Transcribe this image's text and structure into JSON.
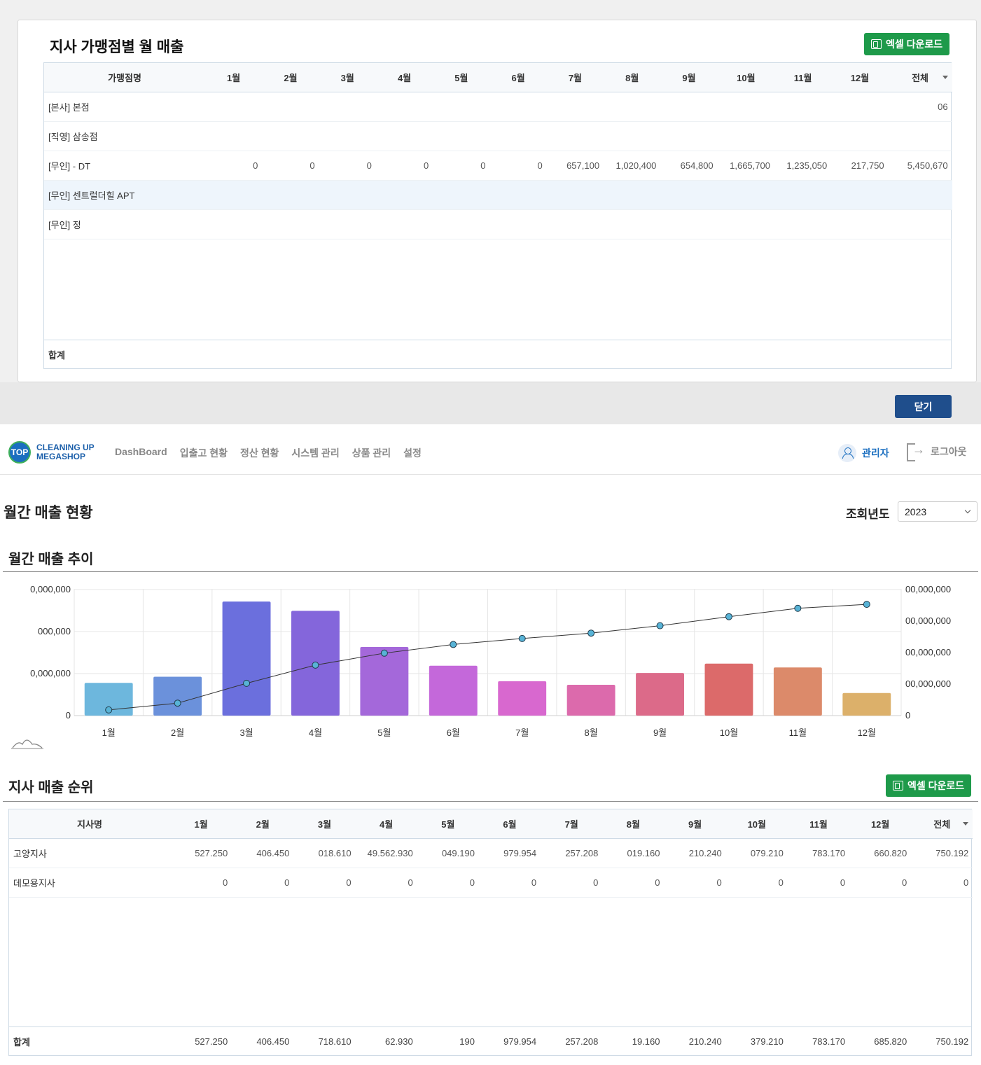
{
  "modal": {
    "title": "지사 가맹점별 월 매출",
    "download_label": "엑셀 다운로드",
    "columns": [
      "가맹점명",
      "1월",
      "2월",
      "3월",
      "4월",
      "5월",
      "6월",
      "7월",
      "8월",
      "9월",
      "10월",
      "11월",
      "12월",
      "전체"
    ],
    "rows": [
      {
        "name": "[본사] 본점",
        "values": [
          "",
          "",
          "",
          "",
          "",
          "",
          "",
          "",
          "",
          "",
          "",
          "",
          "06"
        ]
      },
      {
        "name": "[직영] 삼송점",
        "values": [
          "",
          "",
          "",
          "",
          "",
          "",
          "",
          "",
          "",
          "",
          "",
          "",
          ""
        ]
      },
      {
        "name": "[무인] - DT",
        "values": [
          "0",
          "0",
          "0",
          "0",
          "0",
          "0",
          "657,100",
          "1,020,400",
          "654,800",
          "1,665,700",
          "1,235,050",
          "217,750",
          "5,450,670"
        ]
      },
      {
        "name": "[무인] 센트럴더힐 APT",
        "values": [
          "",
          "",
          "",
          "",
          "",
          "",
          "",
          "",
          "",
          "",
          "",
          "",
          ""
        ]
      },
      {
        "name": "[무인] 정",
        "values": [
          "",
          "",
          "",
          "",
          "",
          "",
          "",
          "",
          "",
          "",
          "",
          "",
          ""
        ]
      }
    ],
    "total_label": "합계",
    "totals": [
      "",
      "",
      "",
      "",
      "",
      "",
      "",
      "",
      "",
      "",
      "",
      "",
      ""
    ],
    "close_label": "닫기"
  },
  "navbar": {
    "logo_mark": "TOP",
    "logo_line1": "CLEANING UP",
    "logo_line2": "MEGASHOP",
    "menu": [
      "DashBoard",
      "입출고 현황",
      "정산 현황",
      "시스템 관리",
      "상품 관리",
      "설정"
    ],
    "user_label": "관리자",
    "logout_label": "로그아웃"
  },
  "page": {
    "title": "월간 매출 현황",
    "year_label": "조회년도",
    "year_value": "2023"
  },
  "trend_section": {
    "title": "월간 매출 추이"
  },
  "ranking": {
    "title": "지사 매출 순위",
    "download_label": "엑셀 다운로드",
    "columns": [
      "지사명",
      "1월",
      "2월",
      "3월",
      "4월",
      "5월",
      "6월",
      "7월",
      "8월",
      "9월",
      "10월",
      "11월",
      "12월",
      "전체"
    ],
    "rows": [
      {
        "name": "고양지사",
        "values": [
          "527.250",
          "406.450",
          "018.610",
          "49.562.930",
          "049.190",
          "979.954",
          "257.208",
          "019.160",
          "210.240",
          "079.210",
          "783.170",
          "660.820",
          "750.192"
        ]
      },
      {
        "name": "데모용지사",
        "values": [
          "0",
          "0",
          "0",
          "0",
          "0",
          "0",
          "0",
          "0",
          "0",
          "0",
          "0",
          "0",
          "0"
        ]
      }
    ],
    "total_label": "합계",
    "totals": [
      "527.250",
      "406.450",
      "718.610",
      "62.930",
      "190",
      "979.954",
      "257.208",
      "19.160",
      "210.240",
      "379.210",
      "783.170",
      "685.820",
      "750.192"
    ]
  },
  "colors": {
    "excel_green": "#1e9a4a",
    "close_blue": "#1f4e8c",
    "brand_blue": "#1b6fc0"
  },
  "chart_data": {
    "type": "bar",
    "categories": [
      "1월",
      "2월",
      "3월",
      "4월",
      "5월",
      "6월",
      "7월",
      "8월",
      "9월",
      "10월",
      "11월",
      "12월"
    ],
    "left_ticks": [
      "0",
      "0,000,000",
      "000,000",
      "0,000,000"
    ],
    "right_ticks": [
      "0",
      "00,000,000",
      "00,000,000",
      "00,000,000",
      "00,000,000"
    ],
    "bar_values": [
      15.5,
      18.4,
      54.0,
      49.6,
      32.5,
      23.6,
      16.3,
      14.6,
      20.2,
      24.6,
      22.8,
      10.7
    ],
    "bar_ylim": [
      0,
      60
    ],
    "line_values": [
      15.5,
      33.9,
      87.9,
      137.5,
      170.0,
      193.6,
      209.9,
      224.5,
      244.7,
      269.3,
      292.1,
      302.8
    ],
    "line_ylim": [
      0,
      345
    ],
    "bar_colors": [
      "#6db7dd",
      "#6b91db",
      "#6b6fdd",
      "#8466db",
      "#a468da",
      "#c468da",
      "#d868cf",
      "#dc6aac",
      "#dc6a89",
      "#dc6a6a",
      "#dc8a6a",
      "#dcb06a"
    ],
    "grid": true
  }
}
